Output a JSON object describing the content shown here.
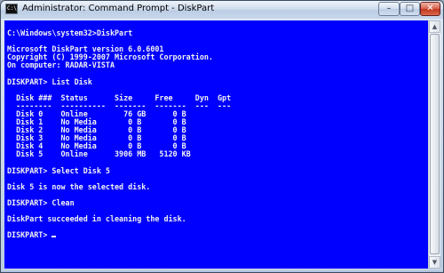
{
  "window": {
    "title": "Administrator: Command Prompt - DiskPart",
    "icon_label": "C:\\",
    "buttons": {
      "minimize_icon": "minimize-icon",
      "maximize_icon": "maximize-icon",
      "close_icon": "close-icon"
    }
  },
  "console": {
    "background_color": "#0000ff",
    "text_color": "#f2f2f2",
    "lines": [
      "C:\\Windows\\system32>DiskPart",
      "",
      "Microsoft DiskPart version 6.0.6001",
      "Copyright (C) 1999-2007 Microsoft Corporation.",
      "On computer: RADAR-VISTA",
      "",
      "DISKPART> List Disk",
      "",
      "  Disk ###  Status      Size     Free     Dyn  Gpt",
      "  --------  ----------  -------  -------  ---  ---",
      "  Disk 0    Online        76 GB      0 B",
      "  Disk 1    No Media       0 B       0 B",
      "  Disk 2    No Media       0 B       0 B",
      "  Disk 3    No Media       0 B       0 B",
      "  Disk 4    No Media       0 B       0 B",
      "  Disk 5    Online      3906 MB   5120 KB",
      "",
      "DISKPART> Select Disk 5",
      "",
      "Disk 5 is now the selected disk.",
      "",
      "DISKPART> Clean",
      "",
      "DiskPart succeeded in cleaning the disk.",
      "",
      "DISKPART> "
    ]
  }
}
